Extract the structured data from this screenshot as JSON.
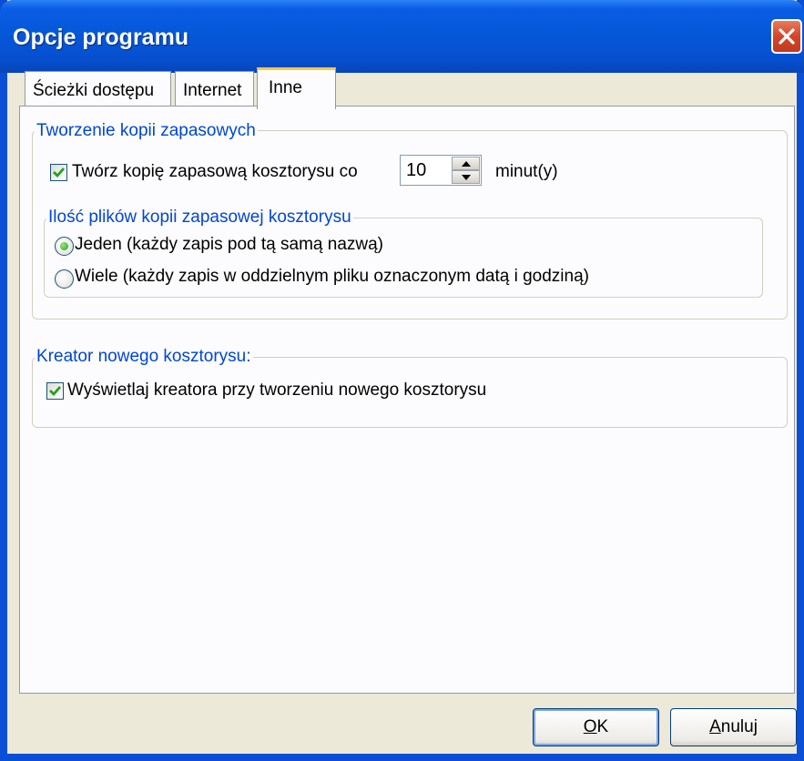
{
  "window": {
    "title": "Opcje programu",
    "close_icon": "close-icon"
  },
  "tabs": [
    {
      "label": "Ścieżki dostępu",
      "active": false
    },
    {
      "label": "Internet",
      "active": false
    },
    {
      "label": "Inne",
      "active": true
    }
  ],
  "backup_group": {
    "legend": "Tworzenie kopii zapasowych",
    "backup_checkbox": {
      "checked": true,
      "label": "Twórz kopię zapasową kosztorysu co"
    },
    "interval_value": "10",
    "interval_unit": "minut(y)",
    "files_group": {
      "legend": "Ilość plików kopii zapasowej kosztorysu",
      "options": [
        {
          "label": "Jeden (każdy zapis pod tą samą nazwą)",
          "selected": true
        },
        {
          "label": "Wiele (każdy zapis w oddzielnym pliku oznaczonym datą i godziną)",
          "selected": false
        }
      ]
    }
  },
  "wizard_group": {
    "legend": "Kreator nowego kosztorysu:",
    "wizard_checkbox": {
      "checked": true,
      "label": "Wyświetlaj kreatora przy tworzeniu nowego kosztorysu"
    }
  },
  "buttons": {
    "ok": {
      "mnemonic": "O",
      "rest": "K"
    },
    "cancel": {
      "mnemonic": "A",
      "rest": "nuluj"
    }
  },
  "colors": {
    "titlebar": "#0558d9",
    "dialog_bg": "#ece9d8",
    "panel_bg": "#fcfcfe",
    "group_legend": "#0046d5",
    "active_tab_accent": "#ffc83c",
    "check_mark": "#21a121"
  }
}
